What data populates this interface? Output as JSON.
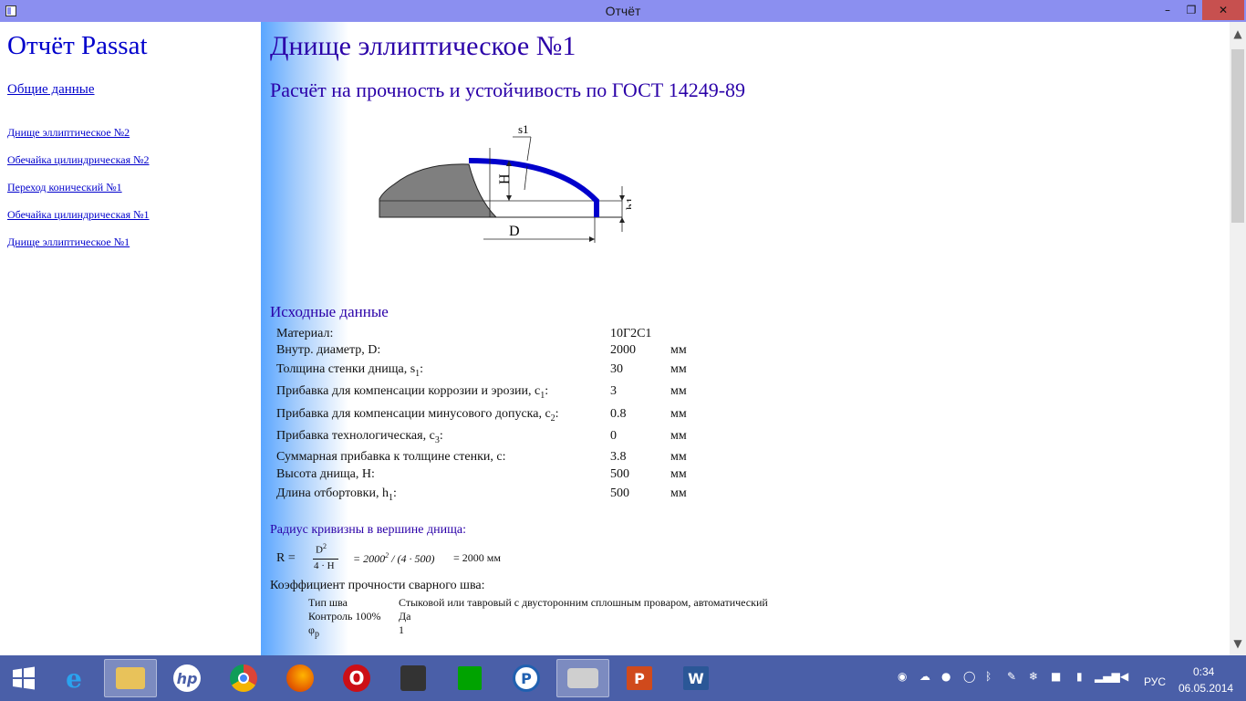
{
  "window": {
    "title": "Отчёт",
    "minimize": "–",
    "maximize": "❐",
    "close": "✕"
  },
  "sidebar": {
    "title": "Отчёт Passat",
    "general": "Общие данные",
    "links": [
      "Днище эллиптическое №2",
      "Обечайка цилиндрическая №2",
      "Переход конический №1",
      "Обечайка цилиндрическая №1",
      "Днище эллиптическое №1"
    ]
  },
  "main": {
    "heading": "Днище эллиптическое №1",
    "subheading": "Расчёт на прочность и устойчивость по ГОСТ 14249-89",
    "diagram": {
      "s1": "s1",
      "H": "H",
      "h1": "h1",
      "D": "D"
    },
    "input_title": "Исходные данные",
    "rows": [
      {
        "label": "Материал:",
        "value": "10Г2С1",
        "unit": ""
      },
      {
        "label": "Внутр. диаметр, D:",
        "value": "2000",
        "unit": "мм"
      },
      {
        "label": "Толщина стенки днища, s",
        "sub": "1",
        "suffix": ":",
        "value": "30",
        "unit": "мм"
      },
      {
        "label": "Прибавка для компенсации коррозии и эрозии, c",
        "sub": "1",
        "suffix": ":",
        "value": "3",
        "unit": "мм"
      },
      {
        "label": "Прибавка для компенсации минусового допуска, c",
        "sub": "2",
        "suffix": ":",
        "value": "0.8",
        "unit": "мм"
      },
      {
        "label": "Прибавка технологическая, c",
        "sub": "3",
        "suffix": ":",
        "value": "0",
        "unit": "мм"
      },
      {
        "label": "Суммарная прибавка к толщине стенки, c:",
        "value": "3.8",
        "unit": "мм"
      },
      {
        "label": "Высота днища, H:",
        "value": "500",
        "unit": "мм"
      },
      {
        "label": "Длина отбортовки, h",
        "sub": "1",
        "suffix": ":",
        "value": "500",
        "unit": "мм"
      }
    ],
    "radius_title": "Радиус кривизны в вершине днища:",
    "formula": {
      "lhs": "R =",
      "num": "D",
      "num_exp": "2",
      "den": "4 · H",
      "expr": "= 2000",
      "expr_exp": "2",
      "expr_tail": " / (4 · 500)",
      "result": "= 2000 мм"
    },
    "weld_title": "Коэффициент прочности сварного шва:",
    "weld": [
      {
        "key": "Тип шва",
        "value": "Стыковой или тавровый с двусторонним сплошным проваром, автоматический"
      },
      {
        "key": "Контроль 100%",
        "value": "Да"
      },
      {
        "key": "φ",
        "key_sub": "p",
        "value": "1"
      }
    ]
  },
  "taskbar": {
    "lang": "РУС",
    "time": "0:34",
    "date": "06.05.2014",
    "apps": [
      "start",
      "internet-explorer",
      "file-explorer",
      "hp",
      "chrome",
      "firefox",
      "opera",
      "media",
      "store",
      "passat",
      "passat-vessel",
      "powerpoint",
      "word"
    ]
  }
}
